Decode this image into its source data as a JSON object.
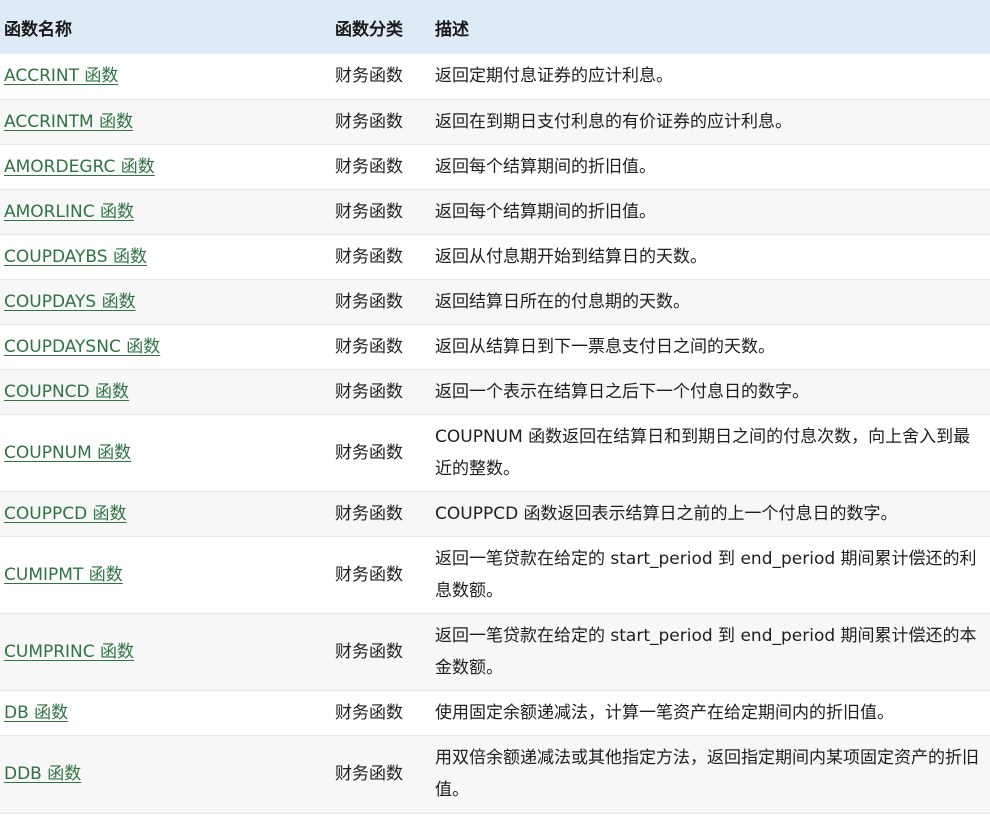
{
  "table": {
    "headers": {
      "name": "函数名称",
      "category": "函数分类",
      "description": "描述"
    },
    "rows": [
      {
        "name": "ACCRINT 函数",
        "category": "财务函数",
        "description": "返回定期付息证券的应计利息。"
      },
      {
        "name": "ACCRINTM 函数",
        "category": "财务函数",
        "description": "返回在到期日支付利息的有价证券的应计利息。"
      },
      {
        "name": "AMORDEGRC 函数",
        "category": "财务函数",
        "description": "返回每个结算期间的折旧值。"
      },
      {
        "name": "AMORLINC 函数",
        "category": "财务函数",
        "description": "返回每个结算期间的折旧值。"
      },
      {
        "name": "COUPDAYBS 函数",
        "category": "财务函数",
        "description": "返回从付息期开始到结算日的天数。"
      },
      {
        "name": "COUPDAYS 函数",
        "category": "财务函数",
        "description": "返回结算日所在的付息期的天数。"
      },
      {
        "name": "COUPDAYSNC 函数",
        "category": "财务函数",
        "description": "返回从结算日到下一票息支付日之间的天数。"
      },
      {
        "name": "COUPNCD 函数",
        "category": "财务函数",
        "description": "返回一个表示在结算日之后下一个付息日的数字。"
      },
      {
        "name": "COUPNUM 函数",
        "category": "财务函数",
        "description": "COUPNUM 函数返回在结算日和到期日之间的付息次数，向上舍入到最近的整数。"
      },
      {
        "name": "COUPPCD 函数",
        "category": "财务函数",
        "description": "COUPPCD 函数返回表示结算日之前的上一个付息日的数字。"
      },
      {
        "name": "CUMIPMT 函数",
        "category": "财务函数",
        "description": "返回一笔贷款在给定的 start_period 到 end_period 期间累计偿还的利息数额。"
      },
      {
        "name": "CUMPRINC 函数",
        "category": "财务函数",
        "description": "返回一笔贷款在给定的 start_period 到 end_period 期间累计偿还的本金数额。"
      },
      {
        "name": "DB 函数",
        "category": "财务函数",
        "description": "使用固定余额递减法，计算一笔资产在给定期间内的折旧值。"
      },
      {
        "name": "DDB 函数",
        "category": "财务函数",
        "description": "用双倍余额递减法或其他指定方法，返回指定期间内某项固定资产的折旧值。"
      }
    ]
  },
  "colors": {
    "header_background": "#deebf7",
    "link": "#2e7340",
    "row_alt_background": "#f7f7f7"
  }
}
